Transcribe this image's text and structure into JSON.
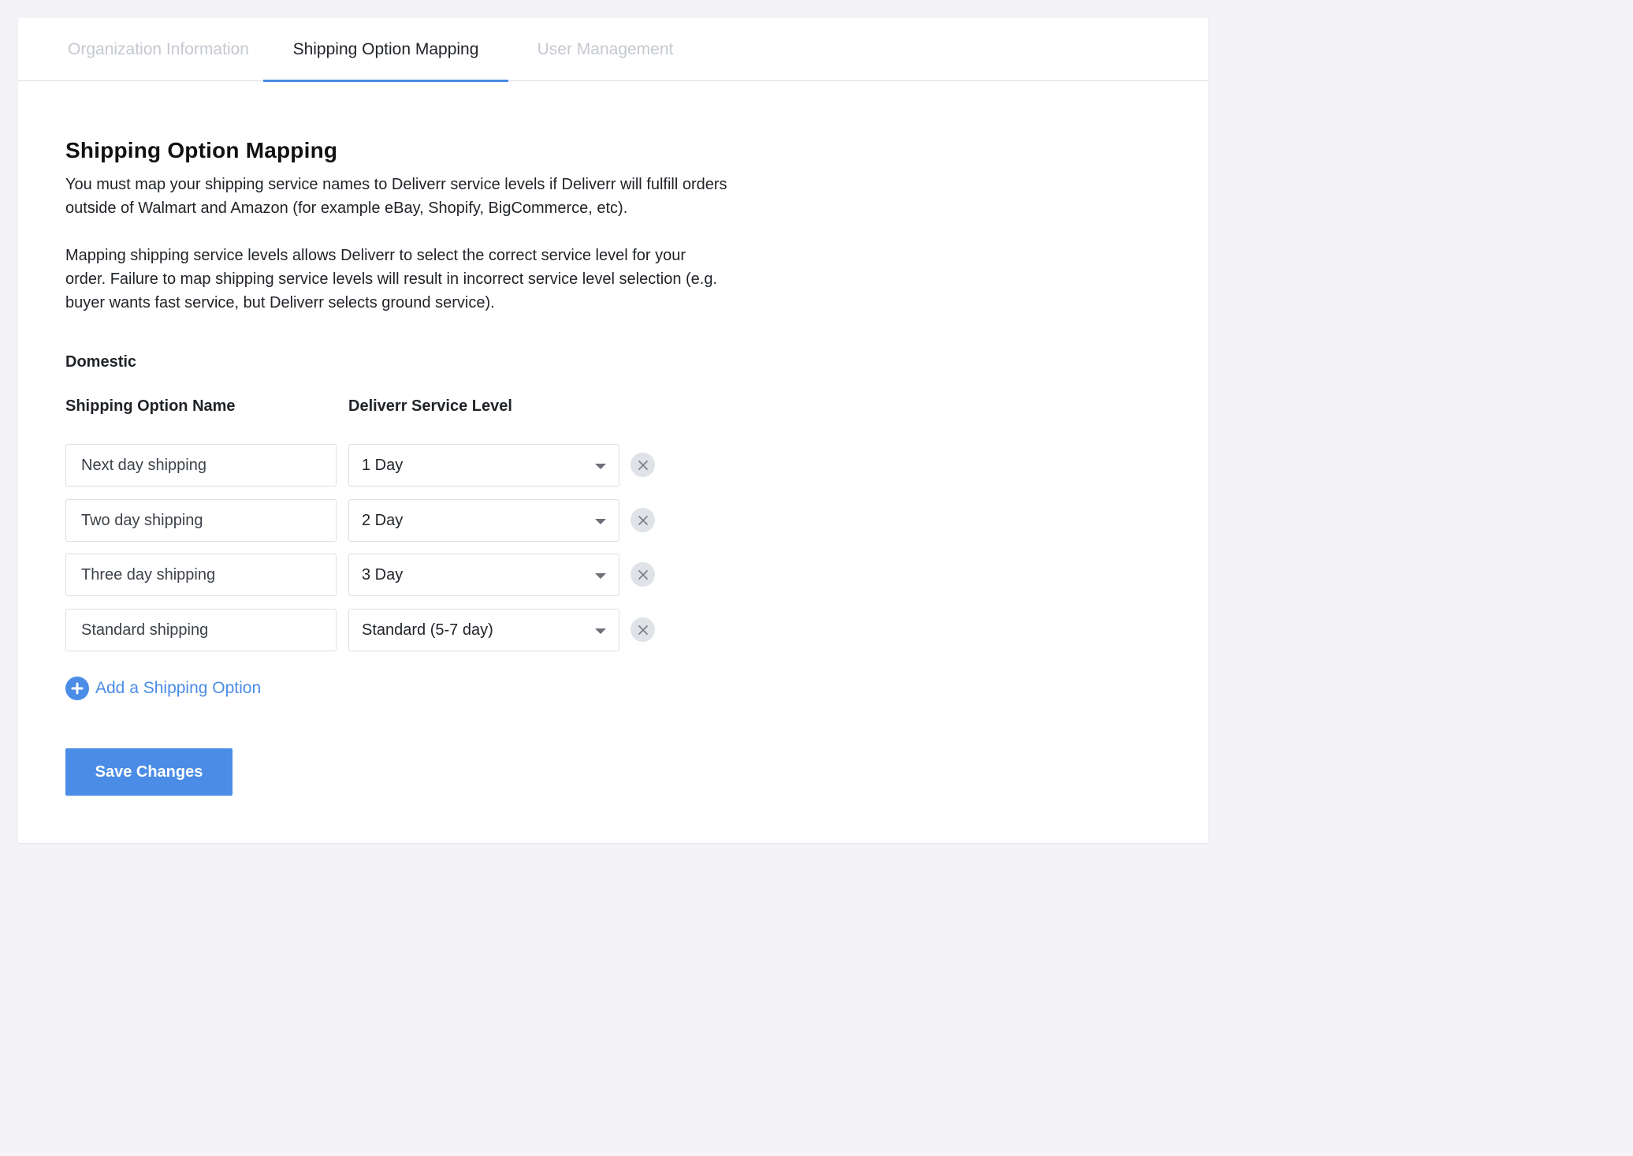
{
  "tabs": [
    {
      "label": "Organization Information",
      "active": false
    },
    {
      "label": "Shipping Option Mapping",
      "active": true
    },
    {
      "label": "User Management",
      "active": false
    }
  ],
  "page": {
    "title": "Shipping Option Mapping",
    "paragraph1": "You must map your shipping service names to Deliverr service levels if Deliverr will fulfill orders outside of Walmart and Amazon (for example eBay, Shopify, BigCommerce, etc).",
    "paragraph2": "Mapping shipping service levels allows Deliverr to select the correct service level for your order. Failure to map shipping service levels will result in incorrect service level selection (e.g. buyer wants fast service, but Deliverr selects ground service)."
  },
  "section": {
    "label": "Domestic",
    "col_name": "Shipping Option Name",
    "col_level": "Deliverr Service Level"
  },
  "rows": [
    {
      "name": "Next day shipping",
      "level": "1 Day"
    },
    {
      "name": "Two day shipping",
      "level": "2 Day"
    },
    {
      "name": "Three day shipping",
      "level": "3 Day"
    },
    {
      "name": "Standard shipping",
      "level": "Standard (5-7 day)"
    }
  ],
  "actions": {
    "add_label": "Add a Shipping Option",
    "save_label": "Save Changes"
  },
  "colors": {
    "accent": "#4a8ce6",
    "inactive_tab": "#c4c8cf",
    "remove_bg": "#dfe2e7"
  }
}
